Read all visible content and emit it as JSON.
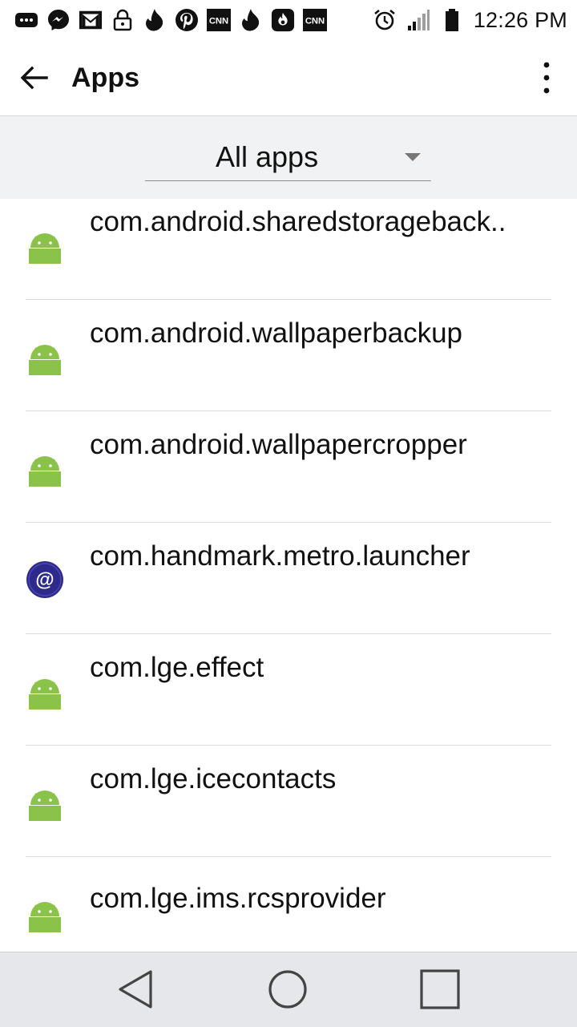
{
  "status_bar": {
    "time": "12:26 PM",
    "notification_icons": [
      "messages-icon",
      "messenger-icon",
      "gmail-icon",
      "lock-icon",
      "tinder-icon",
      "pinterest-icon",
      "cnn-icon",
      "tinder-icon",
      "fire-app-icon",
      "cnn-icon"
    ],
    "system_icons": [
      "alarm-icon",
      "signal-icon",
      "battery-icon"
    ],
    "cnn_text": "CNN"
  },
  "app_bar": {
    "title": "Apps"
  },
  "filter": {
    "selected": "All apps"
  },
  "apps": [
    {
      "name": "com.android.sharedstorageback..",
      "icon": "android-icon"
    },
    {
      "name": "com.android.wallpaperbackup",
      "icon": "android-icon"
    },
    {
      "name": "com.android.wallpapercropper",
      "icon": "android-icon"
    },
    {
      "name": "com.handmark.metro.launcher",
      "icon": "at-sign-icon"
    },
    {
      "name": "com.lge.effect",
      "icon": "android-icon"
    },
    {
      "name": "com.lge.icecontacts",
      "icon": "android-icon"
    },
    {
      "name": "com.lge.ims.rcsprovider",
      "icon": "android-icon"
    }
  ],
  "colors": {
    "android_green": "#8bc34a",
    "metro_blue": "#2e2a8c",
    "filter_bg": "#f1f2f3",
    "nav_bg": "#e6e7ea"
  }
}
